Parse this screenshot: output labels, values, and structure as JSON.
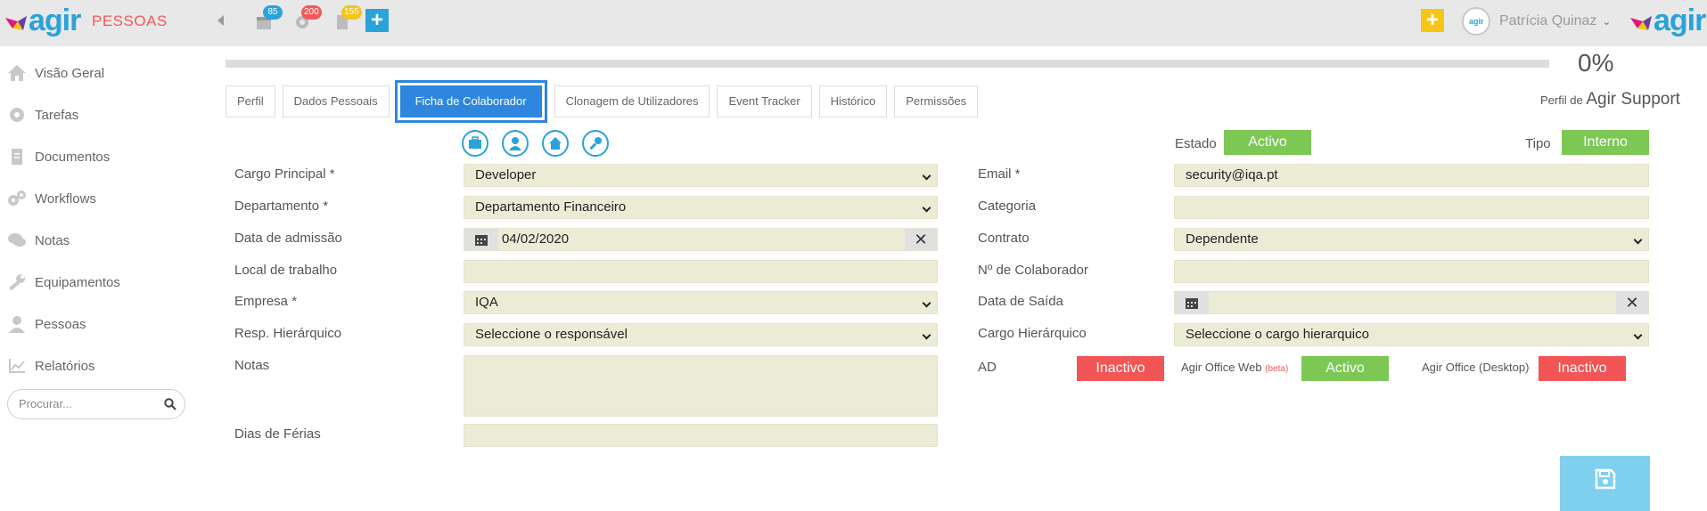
{
  "app": {
    "logo_text": "agir",
    "module": "PESSOAS",
    "notifications": [
      {
        "name": "calendar",
        "count": "85",
        "color": "#2aa3d8"
      },
      {
        "name": "tasks",
        "count": "200",
        "color": "#f05a5a"
      },
      {
        "name": "documents",
        "count": "155",
        "color": "#f5c518"
      }
    ],
    "user_name": "Patrícia Quinaz",
    "avatar_text": "agir"
  },
  "sidebar": {
    "items": [
      {
        "label": "Visão Geral",
        "icon": "home-icon"
      },
      {
        "label": "Tarefas",
        "icon": "gear-icon"
      },
      {
        "label": "Documentos",
        "icon": "document-icon"
      },
      {
        "label": "Workflows",
        "icon": "gears-icon"
      },
      {
        "label": "Notas",
        "icon": "chat-icon"
      },
      {
        "label": "Equipamentos",
        "icon": "wrench-icon"
      },
      {
        "label": "Pessoas",
        "icon": "person-icon"
      },
      {
        "label": "Relatórios",
        "icon": "chart-icon"
      }
    ],
    "search_placeholder": "Procurar..."
  },
  "progress": {
    "value": 0,
    "label": "0%"
  },
  "profile": {
    "prefix": "Perfil de",
    "name": "Agir Support"
  },
  "tabs": [
    {
      "label": "Perfil",
      "active": false
    },
    {
      "label": "Dados Pessoais",
      "active": false
    },
    {
      "label": "Ficha de Colaborador",
      "active": true
    },
    {
      "label": "Clonagem de Utilizadores",
      "active": false
    },
    {
      "label": "Event Tracker",
      "active": false
    },
    {
      "label": "Histórico",
      "active": false
    },
    {
      "label": "Permissões",
      "active": false
    }
  ],
  "shortcuts": [
    "briefcase-icon",
    "user-badge-icon",
    "home-icon",
    "key-icon"
  ],
  "form_left": {
    "cargo_principal": {
      "label": "Cargo Principal *",
      "value": "Developer"
    },
    "departamento": {
      "label": "Departamento *",
      "value": "Departamento Financeiro"
    },
    "data_admissao": {
      "label": "Data de admissão",
      "value": "04/02/2020"
    },
    "local_trabalho": {
      "label": "Local de trabalho",
      "value": ""
    },
    "empresa": {
      "label": "Empresa *",
      "value": "IQA"
    },
    "resp_hierarquico": {
      "label": "Resp. Hierárquico",
      "value": "Seleccione o responsável"
    },
    "notas": {
      "label": "Notas",
      "value": ""
    },
    "dias_ferias": {
      "label": "Dias de Férias",
      "value": ""
    }
  },
  "form_right": {
    "estado": {
      "label": "Estado",
      "value": "Activo"
    },
    "tipo": {
      "label": "Tipo",
      "value": "Interno"
    },
    "email": {
      "label": "Email *",
      "value": "security@iqa.pt"
    },
    "categoria": {
      "label": "Categoria",
      "value": ""
    },
    "contrato": {
      "label": "Contrato",
      "value": "Dependente"
    },
    "n_colaborador": {
      "label": "Nº de Colaborador",
      "value": ""
    },
    "data_saida": {
      "label": "Data de Saída",
      "value": ""
    },
    "cargo_hierarquico": {
      "label": "Cargo Hierárquico",
      "value": "Seleccione o cargo hierarquico"
    },
    "ad": {
      "label": "AD",
      "value": "Inactivo"
    },
    "office_web": {
      "label": "Agir Office Web",
      "beta": "(beta)",
      "value": "Activo"
    },
    "office_desktop": {
      "label": "Agir Office (Desktop)",
      "value": "Inactivo"
    }
  },
  "colors": {
    "brand": "#2aa3d8",
    "active": "#7dc855",
    "inactive": "#f25555",
    "field_bg": "#ececd6",
    "tab_active": "#2e86de"
  }
}
